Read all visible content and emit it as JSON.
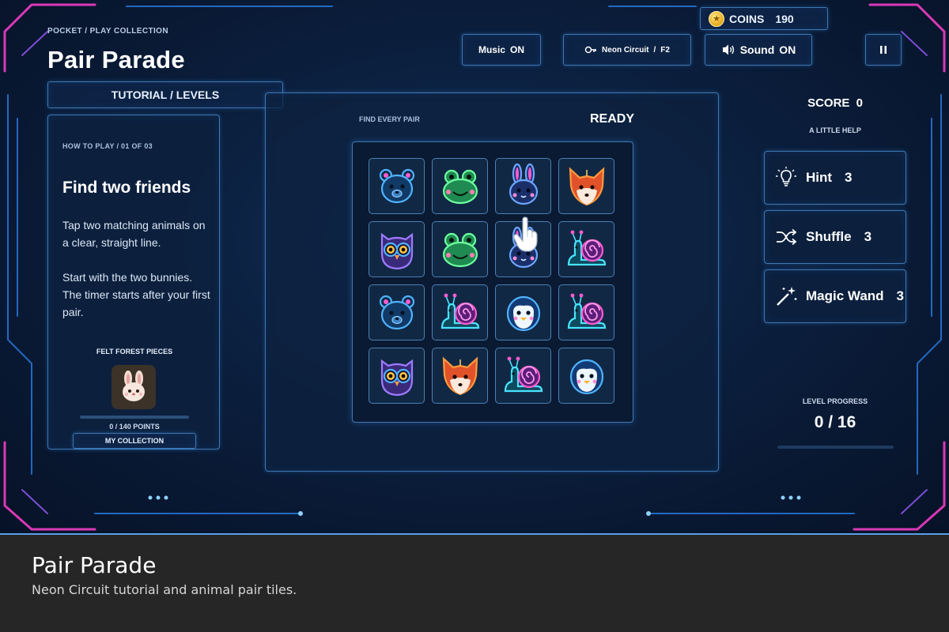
{
  "header": {
    "breadcrumb": "POCKET / PLAY COLLECTION",
    "title": "Pair Parade",
    "tabs_label": "TUTORIAL / LEVELS"
  },
  "topbar": {
    "music_label": "Music",
    "music_state": "ON",
    "theme_name": "Neon Circuit",
    "theme_sep": "/",
    "theme_level": "F2",
    "sound_label": "Sound",
    "sound_state": "ON",
    "coins_label": "COINS",
    "coins_value": "190"
  },
  "tutorial": {
    "step": "HOW TO PLAY / 01 OF 03",
    "title": "Find two friends",
    "p1": "Tap two matching animals on a clear, straight line.",
    "p2": "Start with the two bunnies. The timer starts after your first pair.",
    "pieces_label": "FELT FOREST PIECES",
    "points_text": "0 / 140 POINTS",
    "points_fraction": 0,
    "collection_label": "MY COLLECTION"
  },
  "board": {
    "find_label": "FIND EVERY PAIR",
    "status": "READY",
    "tiles": [
      [
        "bear",
        "frog",
        "bunny",
        "fox"
      ],
      [
        "owl",
        "frog",
        "bunny",
        "snail"
      ],
      [
        "bear",
        "snail",
        "penguin",
        "snail"
      ],
      [
        "owl",
        "fox",
        "snail",
        "penguin"
      ]
    ],
    "pointer_icon": "hand-pointer-icon"
  },
  "sidebar": {
    "score_label": "SCORE",
    "score_value": "0",
    "help_label": "A LITTLE HELP",
    "hint_label": "Hint",
    "hint_count": "3",
    "shuffle_label": "Shuffle",
    "shuffle_count": "3",
    "wand_label": "Magic Wand",
    "wand_count": "3",
    "progress_label": "LEVEL PROGRESS",
    "progress_value": "0 / 16",
    "progress_fraction": 0
  },
  "caption": {
    "title": "Pair Parade",
    "subtitle": "Neon Circuit tutorial and animal pair tiles."
  },
  "colors": {
    "accent": "#3d78b3",
    "neon_blue": "#2f8cff",
    "neon_pink": "#ff3fd0",
    "neon_purple": "#9b5cff",
    "background": "#0b1f3e"
  }
}
